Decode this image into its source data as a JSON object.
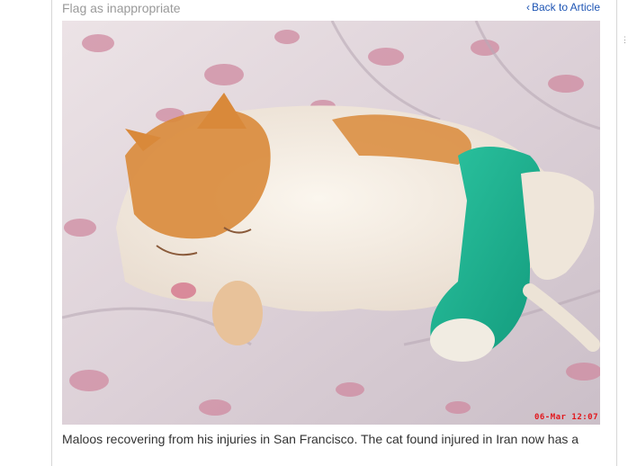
{
  "top": {
    "flag_label": "Flag as inappropriate",
    "back_label": "Back to Article",
    "back_chevron": "‹"
  },
  "photo": {
    "subject": "orange-and-white cat sleeping with green leg cast",
    "timestamp_stamp": "06-Mar 12:07"
  },
  "caption": {
    "text": "Maloos recovering from his injuries in San Francisco. The cat found injured in Iran now has a"
  },
  "colors": {
    "link": "#1e55b4",
    "muted": "#9a9a9a",
    "caption": "#333333",
    "cast": "#1fb08f",
    "fur_orange": "#d9893a"
  }
}
